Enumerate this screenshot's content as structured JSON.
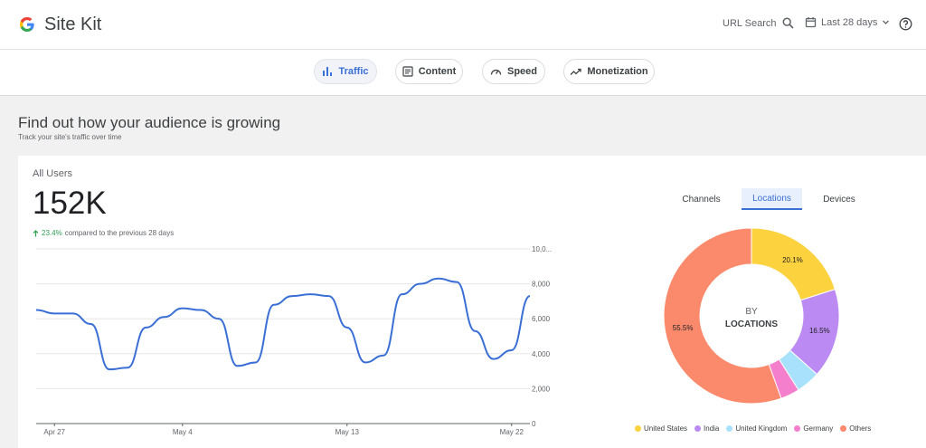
{
  "header": {
    "title": "Site Kit",
    "url_search_label": "URL Search",
    "date_range_label": "Last 28 days"
  },
  "nav": {
    "tabs": [
      {
        "label": "Traffic",
        "active": true
      },
      {
        "label": "Content",
        "active": false
      },
      {
        "label": "Speed",
        "active": false
      },
      {
        "label": "Monetization",
        "active": false
      }
    ]
  },
  "section": {
    "title": "Find out how your audience is growing",
    "subtitle": "Track your site's traffic over time"
  },
  "metric": {
    "label": "All Users",
    "value": "152K",
    "change_pct": "23.4%",
    "change_text": "compared to the previous 28 days"
  },
  "breakdown": {
    "tabs": [
      {
        "label": "Channels",
        "active": false
      },
      {
        "label": "Locations",
        "active": true
      },
      {
        "label": "Devices",
        "active": false
      }
    ],
    "center_line1": "BY",
    "center_line2": "LOCATIONS"
  },
  "colors": {
    "accent": "#3a6fd6",
    "positive": "#2e9e51",
    "line": "#3a6fd6"
  },
  "chart_data": [
    {
      "type": "line",
      "series": [
        {
          "values": [
            6500,
            6300,
            6300,
            5700,
            3100,
            3200,
            5500,
            6100,
            6600,
            6500,
            6000,
            3300,
            3500,
            6800,
            7300,
            7400,
            7300,
            5500,
            3500,
            3900,
            7400,
            8000,
            8300,
            8100,
            5300,
            3700,
            4200,
            7300
          ]
        }
      ],
      "x_tick_labels": [
        "Apr 27",
        "May 4",
        "May 13",
        "May 22"
      ],
      "x_tick_index": [
        1,
        8,
        17,
        26
      ],
      "y_tick_labels": [
        "0",
        "2,000",
        "4,000",
        "6,000",
        "8,000",
        "10,0..."
      ],
      "ylim": [
        0,
        10000
      ],
      "grid": true
    },
    {
      "type": "pie",
      "labels": [
        "United States",
        "India",
        "United Kingdom",
        "Germany",
        "Others"
      ],
      "values": [
        20.1,
        16.5,
        4.4,
        3.5,
        55.5
      ],
      "value_labels": [
        "20.1%",
        "16.5%",
        "",
        "",
        "55.5%"
      ],
      "colors": [
        "#fcd23f",
        "#bb8bf3",
        "#a8e1fb",
        "#f47fcd",
        "#fb8a6c"
      ],
      "legend": "bottom"
    }
  ]
}
